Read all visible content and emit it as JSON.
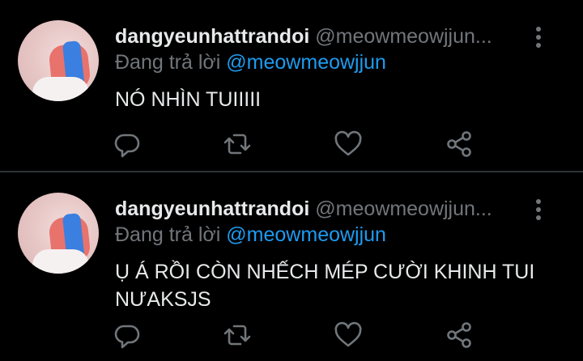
{
  "tweets": [
    {
      "display_name": "dangyeunhattrandoi",
      "handle": "@meowmeowjjun...",
      "replying_prefix": "Đang trả lời",
      "replying_to": "@meowmeowjjun",
      "text": "NÓ NHÌN TUIIIII"
    },
    {
      "display_name": "dangyeunhattrandoi",
      "handle": "@meowmeowjjun...",
      "replying_prefix": "Đang trả lời",
      "replying_to": "@meowmeowjjun",
      "text": "Ụ Á RỒI CÒN NHẾCH MÉP CƯỜI KHINH TUI NƯAKSJS"
    }
  ],
  "icons": {
    "reply": "speech-bubble-icon",
    "retweet": "retweet-icon",
    "like": "heart-icon",
    "share": "share-icon",
    "more": "vertical-dots-icon"
  },
  "colors": {
    "background": "#000000",
    "text": "#e7e9ea",
    "muted": "#71767b",
    "accent": "#1d9bf0",
    "divider": "#2f3336"
  }
}
